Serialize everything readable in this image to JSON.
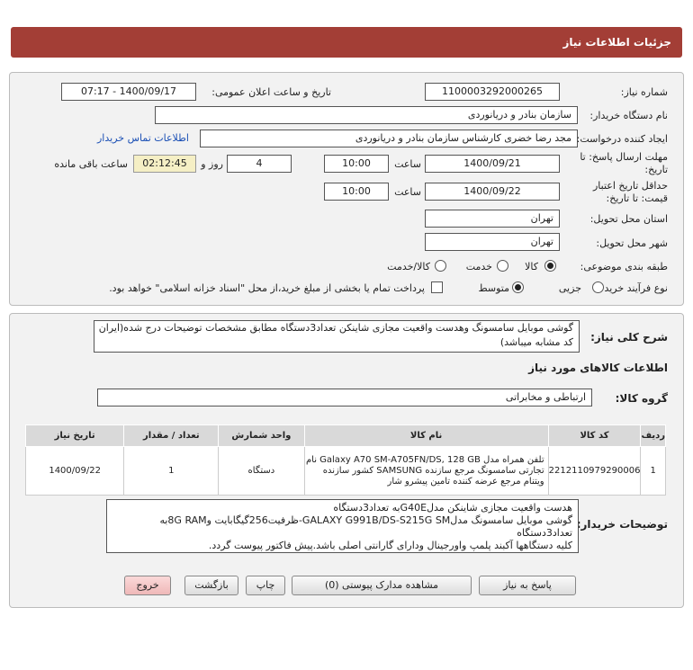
{
  "title": "جزئیات اطلاعات نیاز",
  "fields": {
    "need_number_label": "شماره نیاز:",
    "need_number": "1100003292000265",
    "announce_label": "تاریخ و ساعت اعلان عمومی:",
    "announce_value": "1400/09/17 - 07:17",
    "buyer_org_label": "نام دستگاه خریدار:",
    "buyer_org": "سازمان بنادر و دریانوردی",
    "creator_label": "ایجاد کننده درخواست:",
    "creator": "مجد رضا خضری کارشناس سازمان بنادر و دریانوردی",
    "contact_link": "اطلاعات تماس خریدار",
    "deadline_label_1": "مهلت ارسال پاسخ: تا",
    "deadline_label_2": "تاریخ:",
    "deadline_date": "1400/09/21",
    "time_label": "ساعت",
    "deadline_time": "10:00",
    "days_value": "4",
    "days_label": "روز و",
    "remaining_time": "02:12:45",
    "remaining_label": "ساعت باقی مانده",
    "validity_label_1": "حداقل تاریخ اعتبار",
    "validity_label_2": "قیمت: تا تاریخ:",
    "validity_date": "1400/09/22",
    "validity_time_label": "ساعت",
    "validity_time": "10:00",
    "province_label": "استان محل تحویل:",
    "province": "تهران",
    "city_label": "شهر محل تحویل:",
    "city": "تهران",
    "category_label": "طبقه بندی موضوعی:",
    "category_options": [
      "کالا",
      "خدمت",
      "کالا/خدمت"
    ],
    "process_label": "نوع فرآیند خرید :",
    "process_options": [
      "جزیی",
      "متوسط"
    ],
    "payment_note": "پرداخت تمام یا بخشی از مبلغ خرید،از محل \"اسناد خزانه اسلامی\" خواهد بود."
  },
  "summary": {
    "label": "شرح کلی نیاز:",
    "text": "گوشی موبایل سامسونگ وهدست واقعیت مجازی شاینکن تعداد3دستگاه مطابق مشخصات توضیحات درج شده(ایران کد مشابه میباشد)"
  },
  "goods_section_title": "اطلاعات کالاهای مورد نیاز",
  "goods_group_label": "گروه کالا:",
  "goods_group": "ارتباطی و مخابراتی",
  "table": {
    "headers": [
      "ردیف",
      "کد کالا",
      "نام کالا",
      "واحد شمارش",
      "تعداد / مقدار",
      "تاریخ نیاز"
    ],
    "rows": [
      {
        "index": "1",
        "code": "2212110979290006",
        "name": "تلفن همراه مدل Galaxy A70 SM-A705FN/DS, 128 GB نام تجارتی سامسونگ مرجع سازنده SAMSUNG کشور سازنده ویتنام مرجع عرضه کننده تامین پیشرو شار",
        "unit": "دستگاه",
        "qty": "1",
        "date": "1400/09/22"
      }
    ]
  },
  "buyer_notes": {
    "label": "توضیحات خریدار:",
    "lines": [
      "هدست واقعیت مجازی شاینکن مدلG40Eبه تعداد3دستگاه",
      "گوشی موبایل سامسونگ مدلGALAXY G991B/DS-S215G SM-ظرفیت256گیگابایت و8G RAMبه تعداد3دستگاه",
      "کلیه دستگاهها آکبند پلمپ واورجینال ودارای گارانتی اصلی باشد.پیش فاکتور پیوست گردد."
    ]
  },
  "buttons": {
    "reply": "پاسخ به نیاز",
    "attachments": "مشاهده مدارک پیوستی (0)",
    "print": "چاپ",
    "back": "بازگشت",
    "exit": "خروج"
  },
  "colors": {
    "title_bar": "#a33e36",
    "exit_button": "#f4c6c6",
    "timer_bg": "#f5efc5"
  }
}
